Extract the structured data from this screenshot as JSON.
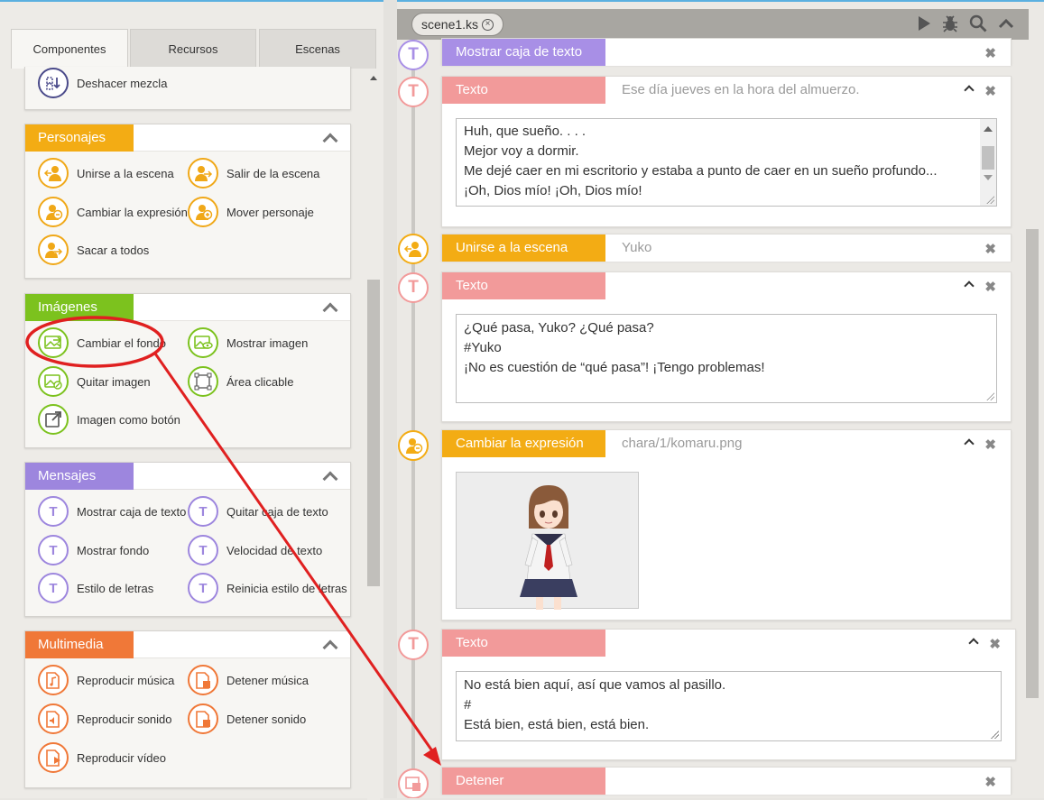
{
  "tabs": [
    "Componentes",
    "Recursos",
    "Escenas"
  ],
  "active_tab": 0,
  "undo_item": "Deshacer mezcla",
  "panels": {
    "personajes": {
      "title": "Personajes",
      "color": "#f3ac14",
      "items": [
        "Unirse a la escena",
        "Salir de la escena",
        "Cambiar la expresión",
        "Mover personaje",
        "Sacar a todos"
      ]
    },
    "imagenes": {
      "title": "Imágenes",
      "color": "#7cc21e",
      "items": [
        "Cambiar el fondo",
        "Mostrar imagen",
        "Quitar imagen",
        "Área clicable",
        "Imagen como botón"
      ]
    },
    "mensajes": {
      "title": "Mensajes",
      "color": "#9d86de",
      "items": [
        "Mostrar caja de texto",
        "Quitar caja de texto",
        "Mostrar fondo",
        "Velocidad de texto",
        "Estilo de letras",
        "Reinicia estilo de letras"
      ]
    },
    "multimedia": {
      "title": "Multimedia",
      "color": "#f07838",
      "items": [
        "Reproducir música",
        "Detener música",
        "Reproducir sonido",
        "Detener sonido",
        "Reproducir vídeo"
      ]
    }
  },
  "file_tab": "scene1.ks",
  "blocks": {
    "b0": {
      "label": "Mostrar caja de texto"
    },
    "b1": {
      "label": "Texto",
      "sub": "Ese día jueves en la hora del almuerzo.",
      "lines": [
        "Huh, que sueño. . . .",
        "Mejor voy a dormir.",
        "Me dejé caer en mi escritorio y estaba a punto de caer en un sueño profundo...",
        "¡Oh, Dios mío! ¡Oh, Dios mío!"
      ]
    },
    "b2": {
      "label": "Unirse a la escena",
      "sub": "Yuko"
    },
    "b3": {
      "label": "Texto",
      "lines": [
        "¿Qué pasa, Yuko? ¿Qué pasa?",
        "#Yuko",
        "¡No es cuestión de “qué pasa”! ¡Tengo problemas!"
      ]
    },
    "b4": {
      "label": "Cambiar la expresión",
      "sub": "chara/1/komaru.png"
    },
    "b5": {
      "label": "Texto",
      "lines": [
        "No está bien aquí, así que vamos al pasillo.",
        "#",
        "Está bien, está bien, está bien."
      ]
    },
    "b6": {
      "label": "Detener"
    }
  },
  "colors": {
    "annotation": "#e02020",
    "text_block": "#f29a9a",
    "character_block": "#f3ac14",
    "message_block": "#a88fe6"
  }
}
